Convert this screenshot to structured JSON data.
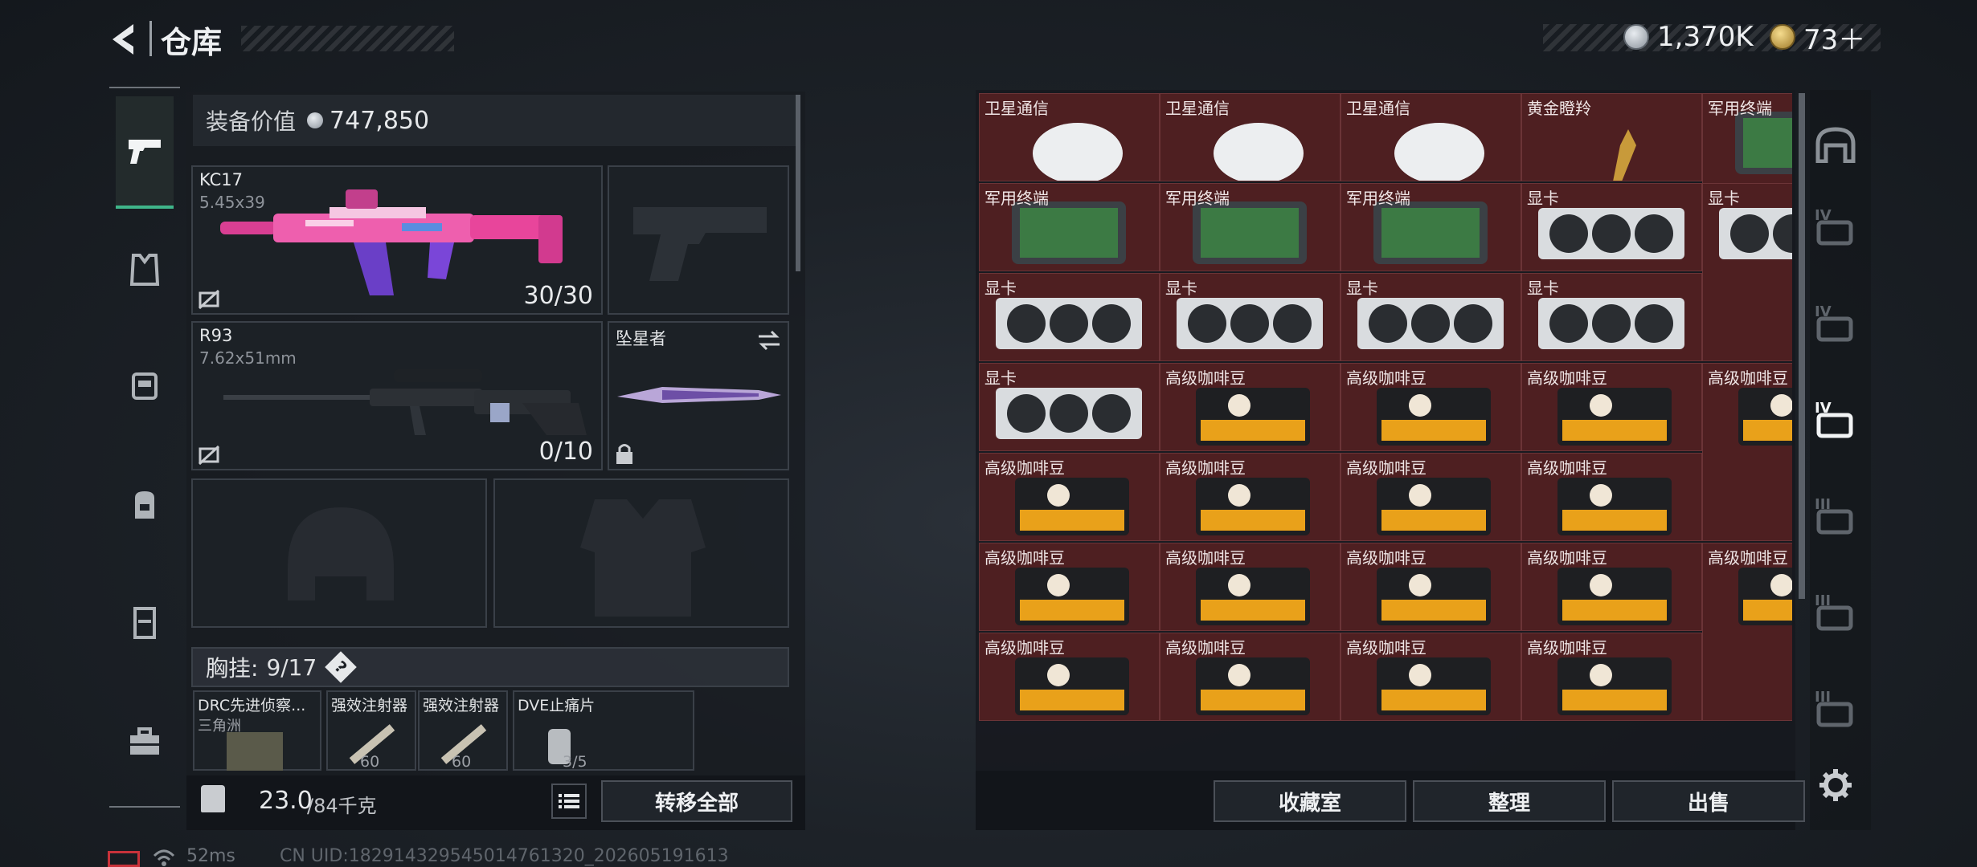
{
  "header": {
    "title": "仓库"
  },
  "currency": {
    "silver": "1,370K",
    "gold": "73＋"
  },
  "equipment": {
    "value_label": "装备价值",
    "value": "747,850"
  },
  "weapons": {
    "primary": {
      "name": "KC17",
      "caliber": "5.45x39",
      "ammo": "30/30"
    },
    "secondary": {
      "name": "R93",
      "caliber": "7.62x51mm",
      "ammo": "0/10"
    },
    "melee": {
      "name": "坠星者"
    }
  },
  "chest_rig": {
    "label": "胸挂:",
    "count": "9/17",
    "help": "?"
  },
  "rig_items": [
    {
      "name": "DRC先进侦察...",
      "sub": "三角洲"
    },
    {
      "name": "强效注射器",
      "sub": "60"
    },
    {
      "name": "强效注射器",
      "sub": "60"
    },
    {
      "name": "DVE止痛片",
      "sub": "3/5"
    }
  ],
  "weight": {
    "current": "23.0",
    "max": "/84千克"
  },
  "buttons": {
    "transfer_all": "转移全部",
    "collection": "收藏室",
    "organize": "整理",
    "sell": "出售"
  },
  "status": {
    "ping": "52ms",
    "uid": "CN UID:18291432954501476132​0_202605191613"
  },
  "stash": {
    "rows": [
      [
        "卫星通信",
        "卫星通信",
        "卫星通信",
        "黄金瞪羚",
        "军用终端"
      ],
      [
        "军用终端",
        "军用终端",
        "军用终端",
        "显卡",
        "显卡"
      ],
      [
        "显卡",
        "显卡",
        "显卡",
        "显卡",
        ""
      ],
      [
        "显卡",
        "高级咖啡豆",
        "高级咖啡豆",
        "高级咖啡豆",
        "高级咖啡豆"
      ],
      [
        "高级咖啡豆",
        "高级咖啡豆",
        "高级咖啡豆",
        "高级咖啡豆",
        ""
      ],
      [
        "高级咖啡豆",
        "高级咖啡豆",
        "高级咖啡豆",
        "高级咖啡豆",
        "高级咖啡豆"
      ],
      [
        "高级咖啡豆",
        "高级咖啡豆",
        "高级咖啡豆",
        "高级咖啡豆",
        ""
      ]
    ]
  },
  "side_tabs": [
    "IV",
    "IV",
    "IV",
    "III",
    "III",
    "III"
  ],
  "colors": {
    "accent_green": "#3fb58a",
    "cell_bg": "#4e1f21",
    "pink": "#e84a9a"
  }
}
